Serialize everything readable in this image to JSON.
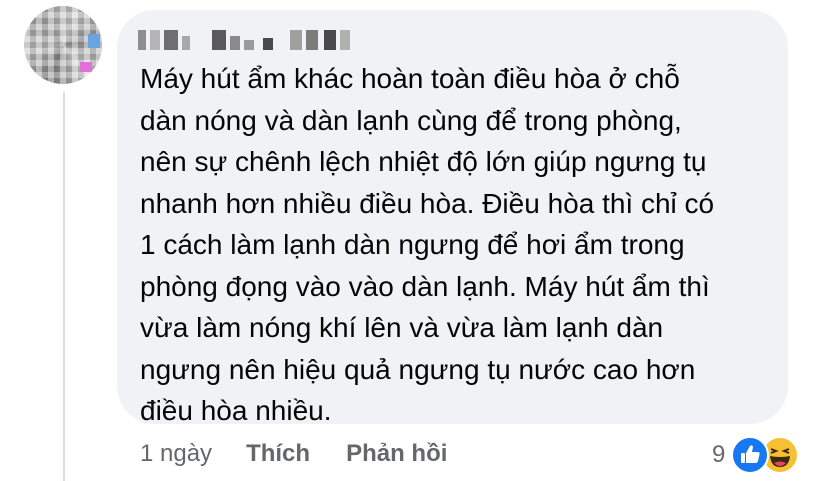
{
  "comment": {
    "text": "Máy hút ẩm khác hoàn toàn điều hòa ở chỗ\ndàn nóng và dàn lạnh cùng để trong phòng,\nnên sự chênh lệch nhiệt độ lớn giúp ngưng tụ\nnhanh hơn nhiều điều hòa. Điều hòa thì chỉ có\n1 cách làm lạnh dàn ngưng để hơi ẩm trong\nphòng đọng vào vào dàn lạnh. Máy hút ẩm thì\nvừa làm nóng khí lên và vừa làm lạnh dàn\nngưng nên hiệu quả ngưng tụ nước cao hơn\nđiều hòa nhiều."
  },
  "actions": {
    "time": "1 ngày",
    "like_label": "Thích",
    "reply_label": "Phản hồi"
  },
  "reactions": {
    "count": "9",
    "icons": [
      "like-icon",
      "haha-icon"
    ]
  },
  "colors": {
    "bubble": "#f0f2f5",
    "meta_text": "#65676b",
    "like_blue": "#1877f2",
    "haha_yellow": "#f7c033"
  }
}
